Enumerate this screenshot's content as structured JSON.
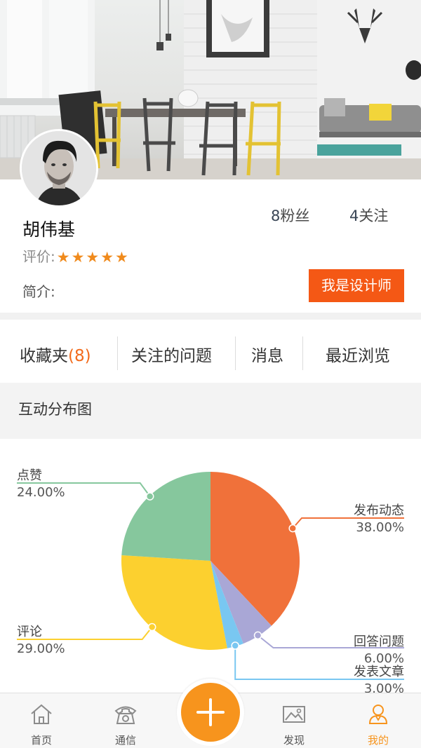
{
  "profile": {
    "name": "胡伟基",
    "rating_label": "评价:",
    "stars": "★★★★★",
    "intro_label": "简介:",
    "fans_count": "8",
    "fans_label": "粉丝",
    "follow_count": "4",
    "follow_label": "关注",
    "designer_button": "我是设计师"
  },
  "tabs": {
    "favorites_label": "收藏夹",
    "favorites_count": "(8)",
    "questions": "关注的问题",
    "messages": "消息",
    "recent": "最近浏览"
  },
  "section": {
    "title": "互动分布图"
  },
  "chart_data": {
    "type": "pie",
    "slices": [
      {
        "label": "发布动态",
        "value": 38.0,
        "display": "38.00%",
        "color": "#f0713a"
      },
      {
        "label": "回答问题",
        "value": 6.0,
        "display": "6.00%",
        "color": "#a9a7d6"
      },
      {
        "label": "发表文章",
        "value": 3.0,
        "display": "3.00%",
        "color": "#79c7f1"
      },
      {
        "label": "评论",
        "value": 29.0,
        "display": "29.00%",
        "color": "#fcd02f"
      },
      {
        "label": "点赞",
        "value": 24.0,
        "display": "24.00%",
        "color": "#86c79d"
      }
    ]
  },
  "bottom_nav": {
    "home": "首页",
    "communication": "通信",
    "discover": "发现",
    "me": "我的"
  },
  "colors": {
    "accent": "#f45815",
    "brand_orange": "#f7941d",
    "star": "#f08a1c"
  }
}
